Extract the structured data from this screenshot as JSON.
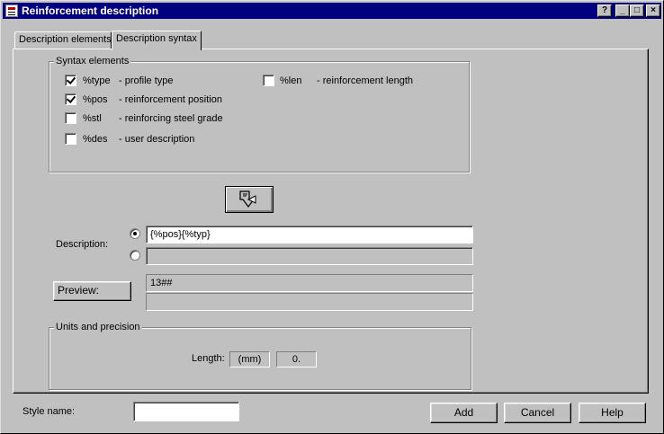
{
  "window": {
    "title": "Reinforcement description",
    "help_button": "?",
    "minimize_button": "_",
    "maximize_button": "□",
    "close_button": "×"
  },
  "tabs": [
    {
      "label": "Description elements",
      "active": false
    },
    {
      "label": "Description syntax",
      "active": true
    }
  ],
  "syntax_elements": {
    "legend": "Syntax elements",
    "items": [
      {
        "code": "%type",
        "desc": "- profile type",
        "checked": true
      },
      {
        "code": "%pos",
        "desc": "- reinforcement position",
        "checked": true
      },
      {
        "code": "%stl",
        "desc": "- reinforcing steel grade",
        "checked": false
      },
      {
        "code": "%des",
        "desc": "- user description",
        "checked": false
      },
      {
        "code": "%len",
        "desc": "- reinforcement length",
        "checked": false
      }
    ]
  },
  "insert_button": {
    "icon": "insert-arrow-icon"
  },
  "description": {
    "label": "Description:",
    "field1_value": "{%pos}{%typ}",
    "field2_value": ""
  },
  "preview": {
    "button_label": "Preview:",
    "field1_value": "13##",
    "field2_value": ""
  },
  "units": {
    "legend": "Units and precision",
    "length_label": "Length:",
    "unit": "(mm)",
    "precision": "0."
  },
  "footer": {
    "style_name_label": "Style name:",
    "style_name_value": "",
    "add_label": "Add",
    "cancel_label": "Cancel",
    "help_label": "Help"
  }
}
